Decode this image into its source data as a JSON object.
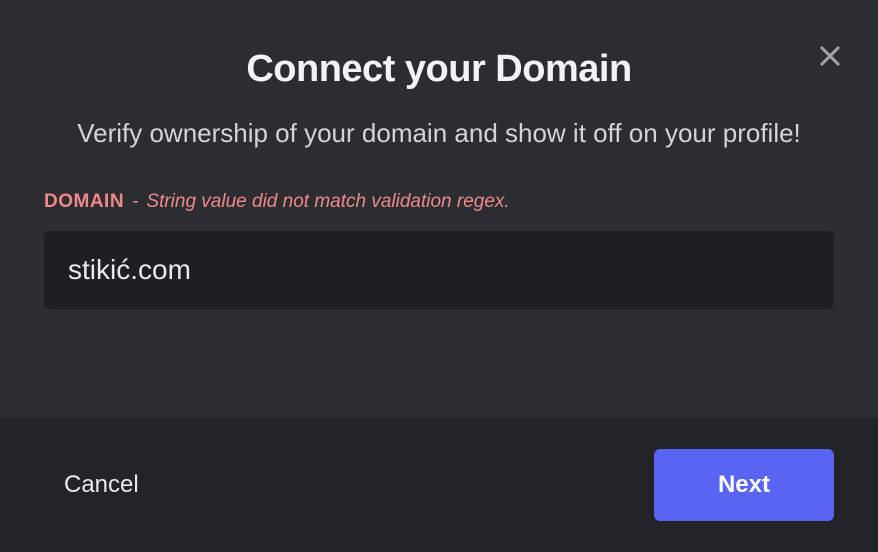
{
  "modal": {
    "title": "Connect your Domain",
    "subtitle": "Verify ownership of your domain and show it off on your profile!",
    "field": {
      "label": "DOMAIN",
      "separator": "-",
      "error": "String value did not match validation regex.",
      "value": "stikić.com"
    },
    "footer": {
      "cancel": "Cancel",
      "next": "Next"
    }
  }
}
